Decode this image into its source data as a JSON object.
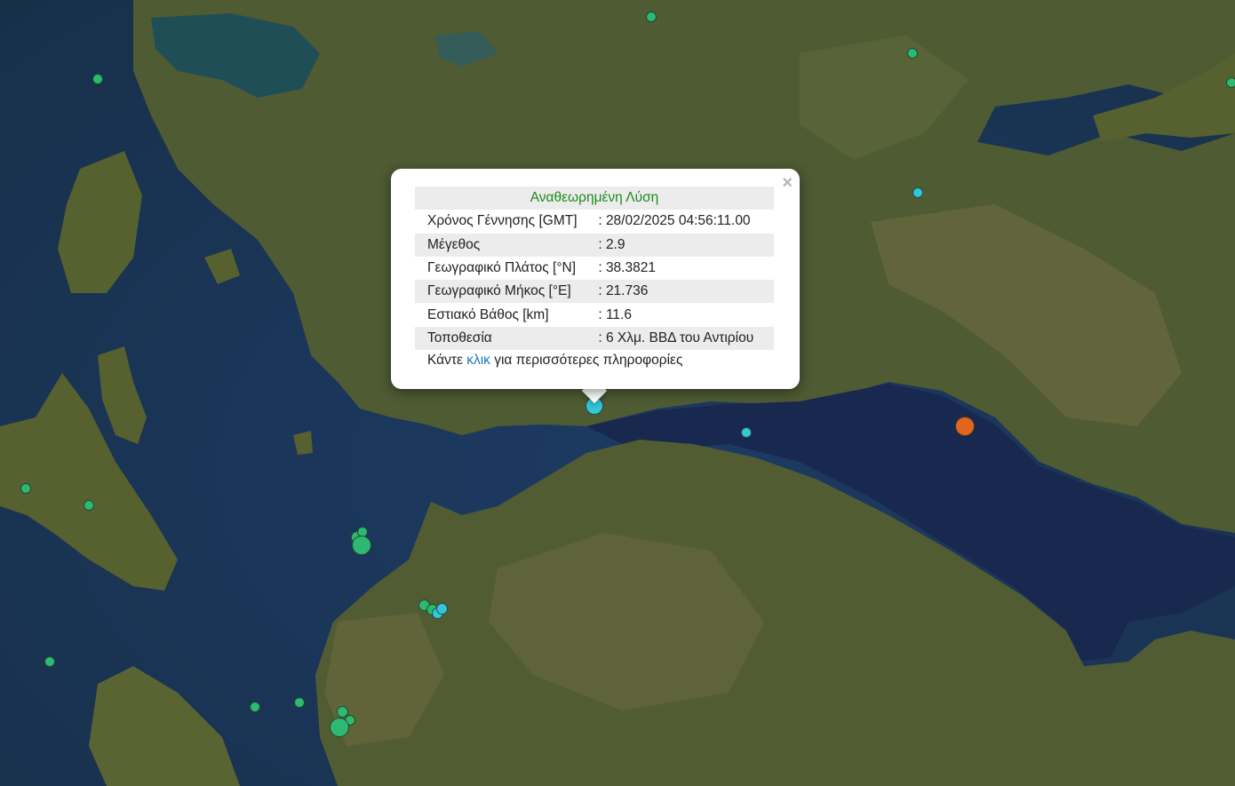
{
  "popup": {
    "title": "Αναθεωρημένη Λύση",
    "close_symbol": "×",
    "rows": [
      {
        "label": "Χρόνος Γέννησης [GMT]",
        "value": ": 28/02/2025 04:56:11.00"
      },
      {
        "label": "Μέγεθος",
        "value": ": 2.9"
      },
      {
        "label": "Γεωγραφικό Πλάτος [°N]",
        "value": ": 38.3821"
      },
      {
        "label": "Γεωγραφικό Μήκος [°E]",
        "value": ": 21.736"
      },
      {
        "label": "Εστιακό Βάθος [km]",
        "value": ": 11.6"
      },
      {
        "label": "Τοποθεσία",
        "value": ": 6 Χλμ. ΒΒΔ του Αντιρίου"
      }
    ],
    "more_prefix": "Κάντε ",
    "more_link": "κλικ",
    "more_suffix": " για περισσότερες πληροφορίες"
  },
  "colors": {
    "marker_green": "#2fb872",
    "marker_cyan": "#35c6d8",
    "marker_orange": "#e0651e",
    "sea": "#1b3550",
    "land": "#4d5a33",
    "title_green": "#1c8a1c",
    "link_blue": "#1a78c2"
  },
  "icons": {
    "close": "close-icon",
    "marker": "earthquake-marker"
  }
}
